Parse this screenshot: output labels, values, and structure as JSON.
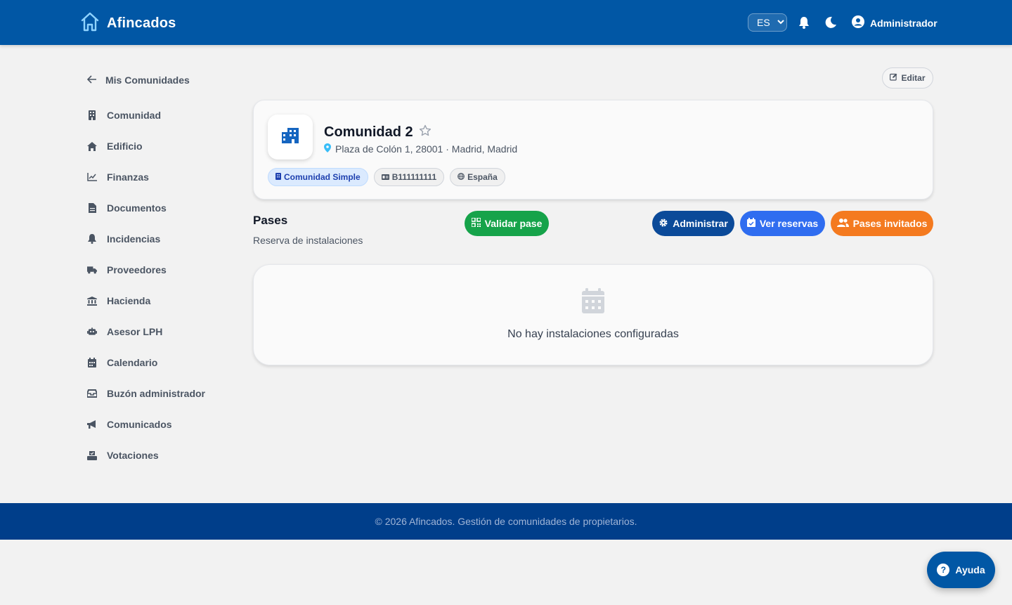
{
  "header": {
    "brand": "Afincados",
    "lang": "ES",
    "user": "Administrador"
  },
  "sidebar": {
    "back": "Mis Comunidades",
    "items": [
      {
        "label": "Comunidad",
        "icon": "building-icon"
      },
      {
        "label": "Edificio",
        "icon": "home-icon"
      },
      {
        "label": "Finanzas",
        "icon": "chart-line-icon"
      },
      {
        "label": "Documentos",
        "icon": "file-icon"
      },
      {
        "label": "Incidencias",
        "icon": "bell-icon"
      },
      {
        "label": "Proveedores",
        "icon": "truck-icon"
      },
      {
        "label": "Hacienda",
        "icon": "bank-icon"
      },
      {
        "label": "Asesor LPH",
        "icon": "robot-icon"
      },
      {
        "label": "Calendario",
        "icon": "calendar-icon"
      },
      {
        "label": "Buzón administrador",
        "icon": "inbox-icon"
      },
      {
        "label": "Comunicados",
        "icon": "megaphone-icon"
      },
      {
        "label": "Votaciones",
        "icon": "ballot-icon"
      }
    ]
  },
  "edit_label": "Editar",
  "community": {
    "name": "Comunidad 2",
    "address": "Plaza de Colón 1, 28001 · Madrid, Madrid",
    "tags": {
      "type": "Comunidad Simple",
      "cif": "B111111111",
      "country": "España"
    }
  },
  "passes": {
    "title": "Pases",
    "subtitle": "Reserva de instalaciones",
    "validate": "Validar pase",
    "manage": "Administrar",
    "reservations": "Ver reservas",
    "guests": "Pases invitados",
    "empty": "No hay instalaciones configuradas"
  },
  "footer": "© 2026 Afincados. Gestión de comunidades de propietarios.",
  "help": "Ayuda",
  "colors": {
    "primary": "#0157a5",
    "footer": "#003e8a",
    "green": "#16a34a",
    "navy": "#0b4a99",
    "blue": "#2f6df0",
    "orange": "#f47a1f"
  }
}
